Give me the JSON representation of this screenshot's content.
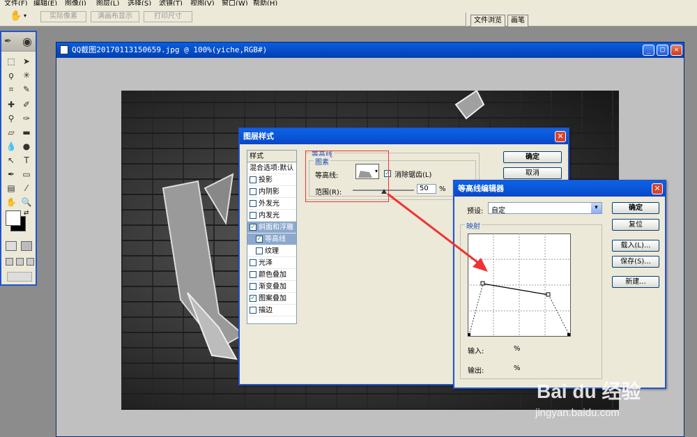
{
  "menubar": {
    "items": [
      "文件(F)",
      "编辑(E)",
      "图像(I)",
      "图层(L)",
      "选择(S)",
      "滤镜(T)",
      "视图(V)",
      "窗口(W)",
      "帮助(H)"
    ]
  },
  "options": {
    "buttons": [
      "实际像素",
      "满画布显示",
      "打印尺寸"
    ],
    "palette_tabs": [
      "文件浏览",
      "画笔"
    ]
  },
  "document": {
    "title": "QQ截图20170113150659.jpg @ 100%(yiche,RGB#)"
  },
  "layer_style": {
    "title": "图层样式",
    "header": "样式",
    "items": [
      {
        "label": "混合选项:默认",
        "checkbox": false,
        "checked": false
      },
      {
        "label": "投影",
        "checkbox": true,
        "checked": false
      },
      {
        "label": "内阴影",
        "checkbox": true,
        "checked": false
      },
      {
        "label": "外发光",
        "checkbox": true,
        "checked": false
      },
      {
        "label": "内发光",
        "checkbox": true,
        "checked": false
      },
      {
        "label": "斜面和浮雕",
        "checkbox": true,
        "checked": true
      },
      {
        "label": "等高线",
        "checkbox": true,
        "checked": true
      },
      {
        "label": "纹理",
        "checkbox": true,
        "checked": false
      },
      {
        "label": "光泽",
        "checkbox": true,
        "checked": false
      },
      {
        "label": "颜色叠加",
        "checkbox": true,
        "checked": false
      },
      {
        "label": "渐变叠加",
        "checkbox": true,
        "checked": false
      },
      {
        "label": "图案叠加",
        "checkbox": true,
        "checked": true
      },
      {
        "label": "描边",
        "checkbox": true,
        "checked": false
      }
    ],
    "group_title": "等高线",
    "subgroup_title": "图素",
    "contour_label": "等高线:",
    "antialias_label": "消除锯齿(L)",
    "antialias_checked": true,
    "range_label": "范围(R):",
    "range_value": "50",
    "range_unit": "%",
    "ok": "确定",
    "cancel": "取消"
  },
  "contour_editor": {
    "title": "等高线编辑器",
    "preset_label": "预设:",
    "preset_value": "自定",
    "mapping_label": "映射",
    "input_label": "输入:",
    "input_unit": "%",
    "output_label": "输出:",
    "output_unit": "%",
    "buttons": {
      "ok": "确定",
      "reset": "复位",
      "load": "载入(L)...",
      "save": "保存(S)...",
      "new": "新建..."
    }
  },
  "watermark": {
    "brand": "Bai du 经验",
    "url": "jingyan.baidu.com"
  },
  "colors": {
    "accent": "#1f54d0",
    "title_bar": "#0a5ee0",
    "highlight": "#e33",
    "selection": "#8ca8cc"
  }
}
